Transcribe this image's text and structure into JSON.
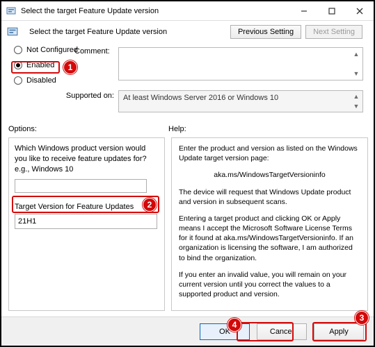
{
  "window": {
    "title": "Select the target Feature Update version"
  },
  "header": {
    "title": "Select the target Feature Update version",
    "prev_setting": "Previous Setting",
    "next_setting": "Next Setting"
  },
  "radios": {
    "not_configured": "Not Configured",
    "enabled": "Enabled",
    "disabled": "Disabled",
    "selected": "enabled"
  },
  "labels": {
    "comment": "Comment:",
    "supported_on": "Supported on:",
    "options": "Options:",
    "help": "Help:"
  },
  "supported_text": "At least Windows Server 2016 or Windows 10",
  "comment_text": "",
  "options": {
    "product_question": "Which Windows product version would you like to receive feature updates for? e.g., Windows 10",
    "product_value": "",
    "target_label": "Target Version for Feature Updates",
    "target_value": "21H1"
  },
  "help": {
    "p1": "Enter the product and version as listed on the Windows Update target version page:",
    "link": "aka.ms/WindowsTargetVersioninfo",
    "p2": "The device will request that Windows Update product and version in subsequent scans.",
    "p3": "Entering a target product and clicking OK or Apply means I accept the Microsoft Software License Terms for it found at aka.ms/WindowsTargetVersioninfo. If an organization is licensing the software, I am authorized to bind the organization.",
    "p4": "If you enter an invalid value, you will remain on your current version until you correct the values to a supported product and version."
  },
  "buttons": {
    "ok": "OK",
    "cancel": "Cancel",
    "apply": "Apply"
  },
  "markers": {
    "m1": "1",
    "m2": "2",
    "m3": "3",
    "m4": "4"
  }
}
